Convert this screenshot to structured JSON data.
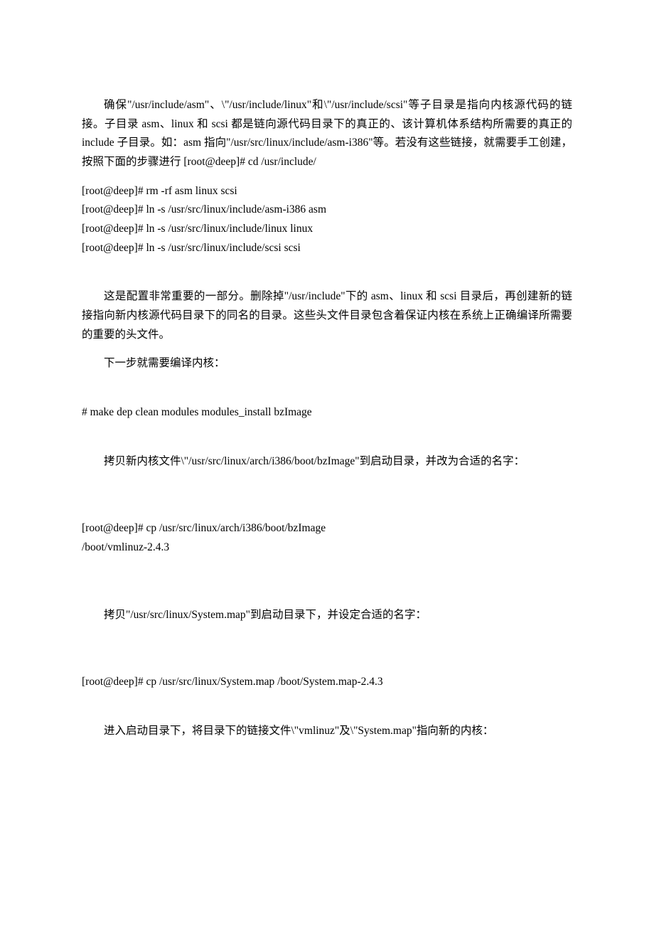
{
  "paragraphs": {
    "p1": "确保\"/usr/include/asm\"、\\\"/usr/include/linux\"和\\\"/usr/include/scsi\"等子目录是指向内核源代码的链接。子目录 asm、linux 和 scsi 都是链向源代码目录下的真正的、该计算机体系结构所需要的真正的 include 子目录。如：asm 指向\"/usr/src/linux/include/asm-i386\"等。若没有这些链接，就需要手工创建，按照下面的步骤进行  [root@deep]# cd /usr/include/",
    "cmd1": "[root@deep]# rm -rf asm linux scsi",
    "cmd2": "[root@deep]# ln -s /usr/src/linux/include/asm-i386 asm",
    "cmd3": "[root@deep]# ln -s /usr/src/linux/include/linux linux",
    "cmd4": "[root@deep]# ln -s /usr/src/linux/include/scsi scsi",
    "p2": "这是配置非常重要的一部分。删除掉\"/usr/include\"下的 asm、linux 和 scsi 目录后，再创建新的链接指向新内核源代码目录下的同名的目录。这些头文件目录包含着保证内核在系统上正确编译所需要的重要的头文件。",
    "p3": "下一步就需要编译内核：",
    "cmd5": "# make dep clean modules modules_install bzImage",
    "p4": "拷贝新内核文件\\\"/usr/src/linux/arch/i386/boot/bzImage\"到启动目录，并改为合适的名字：",
    "cmd6": "[root@deep]# cp /usr/src/linux/arch/i386/boot/bzImage",
    "cmd7": "/boot/vmlinuz-2.4.3",
    "p5": "拷贝\"/usr/src/linux/System.map\"到启动目录下，并设定合适的名字：",
    "cmd8": "[root@deep]# cp /usr/src/linux/System.map /boot/System.map-2.4.3",
    "p6": "进入启动目录下，将目录下的链接文件\\\"vmlinuz\"及\\\"System.map\"指向新的内核："
  }
}
